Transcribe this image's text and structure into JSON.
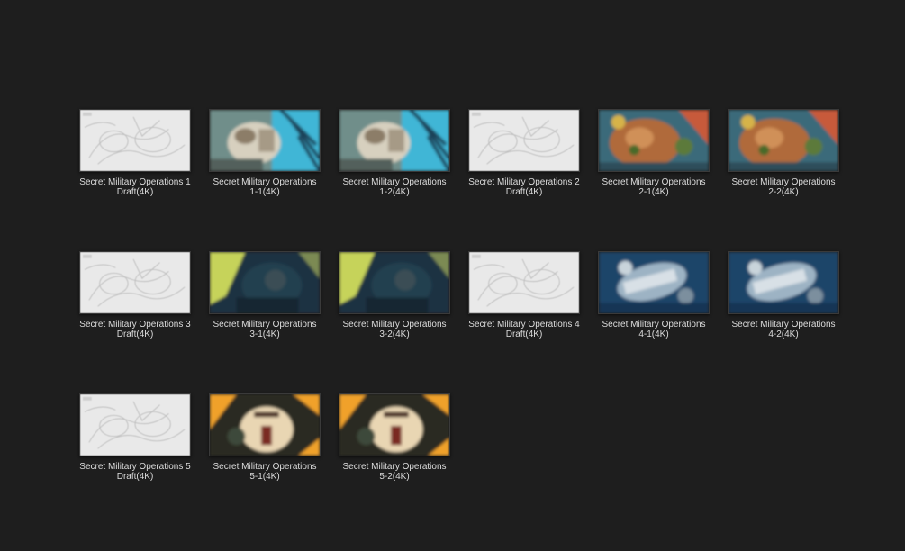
{
  "explorer": {
    "view": "large-icons",
    "files": [
      {
        "name": "Secret Military Operations 1\nDraft(4K)",
        "thumbnail": "sketch"
      },
      {
        "name": "Secret Military Operations\n1-1(4K)",
        "thumbnail": "mech-cyan",
        "accent": "#3fb6d6"
      },
      {
        "name": "Secret Military Operations\n1-2(4K)",
        "thumbnail": "mech-cyan",
        "accent": "#3fb6d6"
      },
      {
        "name": "Secret Military Operations 2\nDraft(4K)",
        "thumbnail": "sketch"
      },
      {
        "name": "Secret Military Operations\n2-1(4K)",
        "thumbnail": "bear-orange",
        "accent": "#d27a33"
      },
      {
        "name": "Secret Military Operations\n2-2(4K)",
        "thumbnail": "bear-orange",
        "accent": "#d27a33"
      },
      {
        "name": "Secret Military Operations 3\nDraft(4K)",
        "thumbnail": "sketch"
      },
      {
        "name": "Secret Military Operations\n3-1(4K)",
        "thumbnail": "cockpit-navy",
        "accent": "#c6d35a"
      },
      {
        "name": "Secret Military Operations\n3-2(4K)",
        "thumbnail": "cockpit-navy",
        "accent": "#c6d35a"
      },
      {
        "name": "Secret Military Operations 4\nDraft(4K)",
        "thumbnail": "sketch"
      },
      {
        "name": "Secret Military Operations\n4-1(4K)",
        "thumbnail": "robot-blue",
        "accent": "#2f6fa6"
      },
      {
        "name": "Secret Military Operations\n4-2(4K)",
        "thumbnail": "robot-blue",
        "accent": "#2f6fa6"
      },
      {
        "name": "Secret Military Operations 5\nDraft(4K)",
        "thumbnail": "sketch"
      },
      {
        "name": "Secret Military Operations\n5-1(4K)",
        "thumbnail": "hero-amber",
        "accent": "#f0a12b"
      },
      {
        "name": "Secret Military Operations\n5-2(4K)",
        "thumbnail": "hero-amber",
        "accent": "#f0a12b"
      }
    ]
  }
}
